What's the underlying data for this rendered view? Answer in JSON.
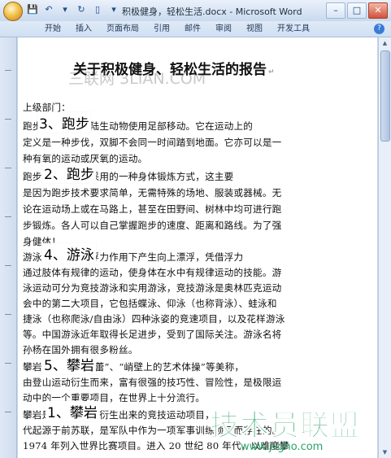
{
  "window": {
    "title": "积极健身，轻松生活.docx - Microsoft Word",
    "controls": {
      "minimize": "–",
      "maximize": "□",
      "close": "✕"
    }
  },
  "quick_access": [
    {
      "icon": "save-icon",
      "glyph": "💾"
    },
    {
      "icon": "undo-icon",
      "glyph": "↶"
    },
    {
      "icon": "undo-dropdown-icon",
      "glyph": "▾"
    },
    {
      "icon": "redo-icon",
      "glyph": "↻"
    },
    {
      "icon": "new-document-icon",
      "glyph": "▯"
    },
    {
      "icon": "customize-qat-icon",
      "glyph": "▾"
    }
  ],
  "ribbon": {
    "tabs": [
      "开始",
      "插入",
      "页面布局",
      "引用",
      "邮件",
      "审阅",
      "视图",
      "开发工具"
    ],
    "help": "?"
  },
  "document": {
    "watermark": "三联网 3LIAN.COM",
    "title": "关于积极健身、轻松生活的报告",
    "lines": [
      "上级部门：",
      "跑步的定义是指陆生动物使用足部移动。它在运动上的",
      "定义是一种步伐，双脚不会同一时间踏到地面。它亦可以是一",
      "种有氧的运动或厌氧的运动。",
      "跑步是人们最常采用的一种身体锻炼方式，这主要",
      "是因为跑步技术要求简单，无需特殊的场地、服装或器械。无",
      "论在运动场上或在马路上，甚至在田野间、树林中均可进行跑",
      "步锻炼。各人可以自己掌握跑步的速度、距离和路线。为了强",
      "身健体！",
      "游泳是人在水的浮力作用下产生向上漂浮，凭借浮力",
      "通过肢体有规律的运动，使身体在水中有规律运动的技能。游",
      "泳运动可分为竞技游泳和实用游泳，竞技游泳是奥林匹克运动",
      "会中的第二大项目，它包括蝶泳、仰泳（也称背泳）、蛙泳和",
      "捷泳（也称爬泳/自由泳）四种泳姿的竞速项目，以及花样游泳",
      "等。中国游泳近年取得长足进步，受到了国际关注。游泳名将",
      "孙杨在国外拥有很多粉丝。",
      "攀岩素有“岩壁芭蕾”、“峭壁上的艺术体操”等美称，",
      "由登山运动衍生而来，富有很强的技巧性、冒险性，是极限运",
      "动中的一个重要项目，在世界上十分流行。",
      "攀岩是登山运动中衍生出来的竞技运动项目，",
      "代起源于前苏联，是军队中作为一项军事训练项目而存在的。",
      "1974 年列入世界比赛项目。进入 20 世纪 80 年代，以难度攀"
    ],
    "subheadings": [
      "3、跑步",
      "2、跑步",
      "4、游泳",
      "5、攀岩",
      "1、攀岩"
    ],
    "paragraph_mark": "↵"
  },
  "overlay_logo": {
    "main": "技术员联盟",
    "url": "www.jsgho.com"
  },
  "colors": {
    "logo_green": "#2aa36a",
    "ribbon_blue": "#cfdff2"
  }
}
